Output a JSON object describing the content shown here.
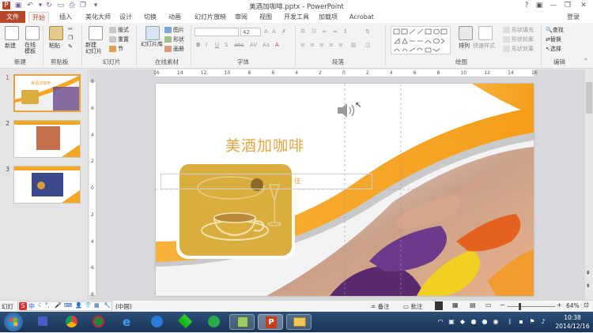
{
  "window": {
    "title": "美酒加咖啡.pptx - PowerPoint",
    "login": "登录"
  },
  "tabs": [
    {
      "label": "文件",
      "file": true
    },
    {
      "label": "开始",
      "active": true
    },
    {
      "label": "插入"
    },
    {
      "label": "美化大师"
    },
    {
      "label": "设计"
    },
    {
      "label": "切换"
    },
    {
      "label": "动画"
    },
    {
      "label": "幻灯片放映"
    },
    {
      "label": "审阅"
    },
    {
      "label": "视图"
    },
    {
      "label": "开发工具"
    },
    {
      "label": "加载项"
    },
    {
      "label": "Acrobat"
    }
  ],
  "ribbon": {
    "groups": {
      "new": "新建",
      "clipboard": "剪贴板",
      "slides": "幻灯片",
      "online": "在线素材",
      "font": "字体",
      "paragraph": "段落",
      "drawing": "绘图",
      "editing": "编辑"
    },
    "buttons": {
      "new": "新建",
      "online_template": "在线\n模板",
      "paste": "粘贴",
      "new_slide": "新建\n幻灯片",
      "layout": "版式",
      "reset": "重置",
      "section": "节",
      "gallery": "幻灯片库",
      "picture": "图片",
      "shape": "形状",
      "canvas": "画册",
      "arrange": "排列",
      "quick_styles": "快速样式",
      "shape_fill": "形状填充",
      "shape_outline": "形状轮廓",
      "shape_effects": "形状效果",
      "find": "查找",
      "replace": "替换",
      "select": "选择"
    },
    "font_size": "42"
  },
  "ruler": {
    "h_ticks": [
      "16",
      "14",
      "12",
      "10",
      "8",
      "6",
      "4",
      "2",
      "0",
      "2",
      "4",
      "6",
      "8",
      "10",
      "12",
      "14",
      "16"
    ],
    "v_ticks": [
      "8",
      "6",
      "4",
      "2",
      "0",
      "2",
      "4",
      "6",
      "8"
    ]
  },
  "slides": [
    {
      "num": "1",
      "selected": true
    },
    {
      "num": "2"
    },
    {
      "num": "3"
    }
  ],
  "slide": {
    "title": "美酒加咖啡",
    "subtitle_placeholder": "佳"
  },
  "thumb1": {
    "title": "美酒加咖啡"
  },
  "status": {
    "slide_info": "幻灯",
    "lang": "(中国)",
    "notes": "备注",
    "comments": "批注",
    "zoom": "64%"
  },
  "taskbar": {
    "time": "10:38",
    "date": "2014/12/16"
  },
  "colors": {
    "accent": "#b7472a",
    "orange": "#f5a623",
    "gold": "#d9ae3f"
  }
}
